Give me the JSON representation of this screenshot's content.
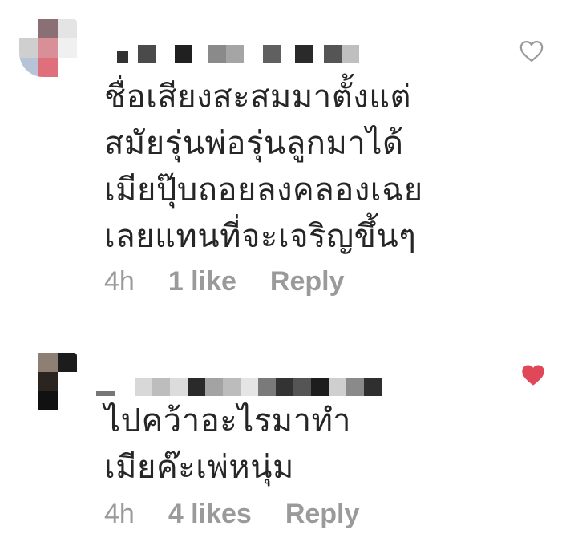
{
  "comments": [
    {
      "text": "ชื่อเสียงสะสมมาตั้งแต่\nสมัยรุ่นพ่อรุ่นลูกมาได้\nเมียปุ๊บถอยลงคลองเฉย\nเลยแทนที่จะเจริญขึ้นๆ",
      "time": "4h",
      "likes": "1 like",
      "reply": "Reply",
      "liked": false,
      "heart_icon": "heart-outline-icon",
      "heart_color": "#9a9a9a"
    },
    {
      "text": "ไปคว้าอะไรมาทำ\nเมียค๊ะเพ่หนุ่ม",
      "time": "4h",
      "likes": "4 likes",
      "reply": "Reply",
      "liked": true,
      "heart_icon": "heart-filled-icon",
      "heart_color": "#e0485a"
    }
  ],
  "colors": {
    "text": "#262626",
    "meta": "#9a9a9a",
    "liked_heart": "#e0485a"
  }
}
